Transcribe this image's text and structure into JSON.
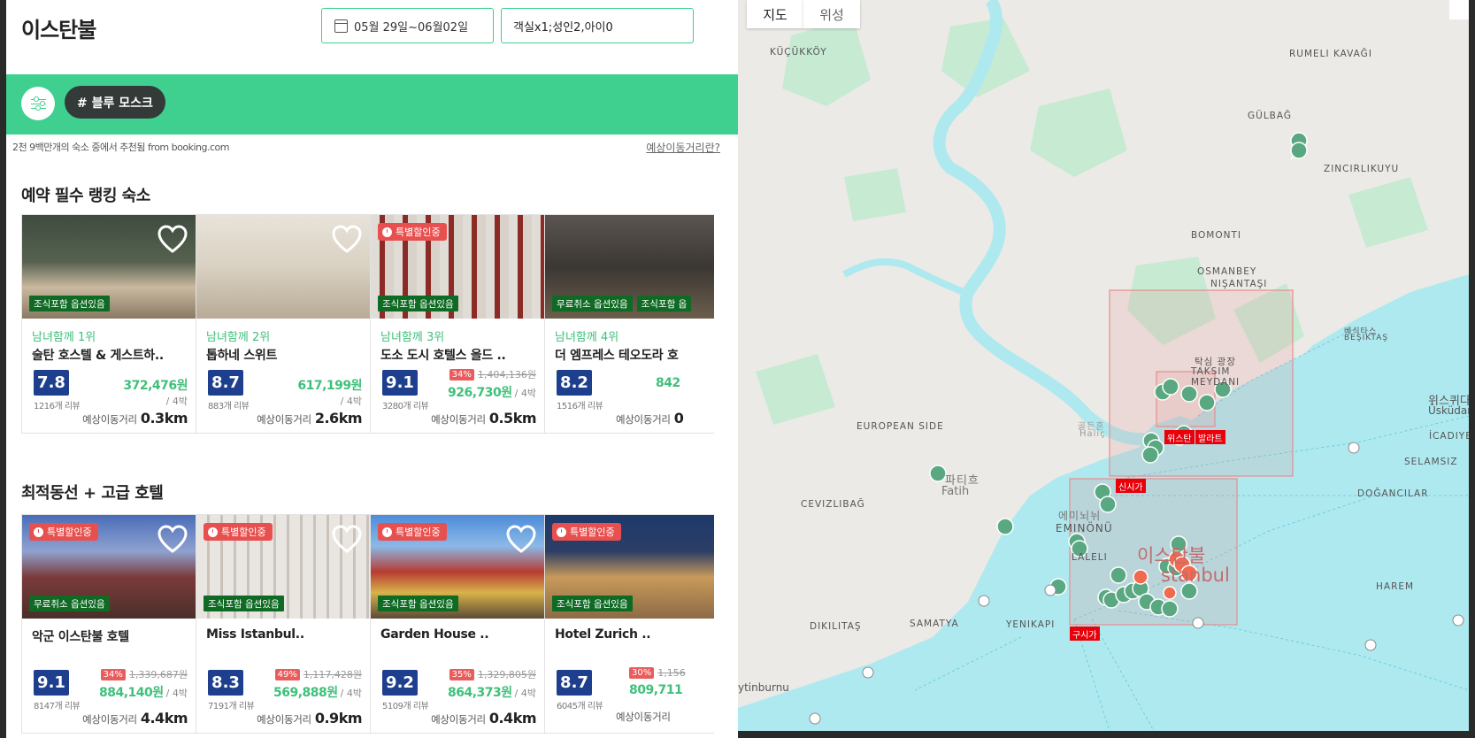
{
  "header": {
    "city": "이스탄불",
    "date_range": "05월 29일~06월02일",
    "rooms": "객실x1;성인2,아이0"
  },
  "filter_bar": {
    "tag": "# 블루 모스크"
  },
  "info": {
    "recommend_text": "2천 9백만개의 숙소 중에서 추천됨 from booking.com",
    "distance_link": "예상이동거리란?"
  },
  "sections": [
    {
      "title": "예약 필수 랭킹 숙소",
      "cards": [
        {
          "rank": "남녀함께 1위",
          "name": "술탄 호스텔 & 게스트하..",
          "score": "7.8",
          "reviews": "1216개 리뷰",
          "price": "372,476원",
          "per": "/ 4박",
          "dist_label": "예상이동거리",
          "dist": "0.3km",
          "badges": [
            "조식포함 옵션있음"
          ],
          "special": ""
        },
        {
          "rank": "남녀함께 2위",
          "name": "톱하네 스위트",
          "score": "8.7",
          "reviews": "883개 리뷰",
          "price": "617,199원",
          "per": "/ 4박",
          "dist_label": "예상이동거리",
          "dist": "2.6km",
          "badges": [],
          "special": ""
        },
        {
          "rank": "남녀함께 3위",
          "name": "도소 도시 호텔스 올드 ..",
          "score": "9.1",
          "reviews": "3280개 리뷰",
          "discount": "34%",
          "original": "1,404,136원",
          "price": "926,730원",
          "per": "/ 4박",
          "dist_label": "예상이동거리",
          "dist": "0.5km",
          "badges": [
            "조식포함 옵션있음"
          ],
          "special": "특별할인중"
        },
        {
          "rank": "남녀함께 4위",
          "name": "더 엠프레스 테오도라 호",
          "score": "8.2",
          "reviews": "1516개 리뷰",
          "price": "842",
          "per": "",
          "dist_label": "예상이동거리",
          "dist": "0",
          "badges": [
            "무료취소 옵션있음",
            "조식포함 옵"
          ],
          "special": ""
        }
      ]
    },
    {
      "title": "최적동선 + 고급 호텔",
      "cards": [
        {
          "rank": "",
          "name": "악군 이스탄불 호텔",
          "score": "9.1",
          "reviews": "8147개 리뷰",
          "discount": "34%",
          "original": "1,339,687원",
          "price": "884,140원",
          "per": "/ 4박",
          "dist_label": "예상이동거리",
          "dist": "4.4km",
          "badges": [
            "무료취소 옵션있음"
          ],
          "special": "특별할인중"
        },
        {
          "rank": "",
          "name": "Miss Istanbul..",
          "score": "8.3",
          "reviews": "7191개 리뷰",
          "discount": "49%",
          "original": "1,117,428원",
          "price": "569,888원",
          "per": "/ 4박",
          "dist_label": "예상이동거리",
          "dist": "0.9km",
          "badges": [
            "조식포함 옵션있음"
          ],
          "special": "특별할인중"
        },
        {
          "rank": "",
          "name": "Garden House ..",
          "score": "9.2",
          "reviews": "5109개 리뷰",
          "discount": "35%",
          "original": "1,329,805원",
          "price": "864,373원",
          "per": "/ 4박",
          "dist_label": "예상이동거리",
          "dist": "0.4km",
          "badges": [
            "조식포함 옵션있음"
          ],
          "special": "특별할인중"
        },
        {
          "rank": "",
          "name": "Hotel Zurich ..",
          "score": "8.7",
          "reviews": "6045개 리뷰",
          "discount": "30%",
          "original": "1,156",
          "price": "809,711",
          "per": "",
          "dist_label": "예상이동거리",
          "dist": "",
          "badges": [
            "조식포함 옵션있음"
          ],
          "special": "특별할인중"
        }
      ]
    }
  ],
  "map": {
    "tab_map": "지도",
    "tab_satellite": "위성",
    "labels": [
      "KÜÇÜKKÖY",
      "RUMELI KAVAĞI",
      "GÜLBAĞ",
      "ZINCIRLIKUYU",
      "BOMONTI",
      "OSMANBEY",
      "NIŞANTAŞI",
      "EUROPEAN SIDE",
      "CEVIZLIBAĞ",
      "DIKILITAŞ",
      "SAMATYA",
      "YENIKAPI",
      "DOĞANCILAR",
      "SELAMSIZ",
      "HAREM",
      "İCADIYE",
      "ytinburnu",
      "EMINÖNÜ",
      "LALELI",
      "탁심 광장",
      "TAKSIM",
      "MEYDANI",
      "베식타스",
      "BEŞIKTAŞ",
      "위스퀴다르",
      "Üsküdar",
      "골든혼",
      "Haliç",
      "파티흐",
      "Fatih",
      "에미뇌뉘",
      "이스탄불",
      "stanbul"
    ],
    "red_tags": [
      "신시가",
      "구시가",
      "위스탄",
      "발라트"
    ],
    "colors": {
      "water": "#aee9f0",
      "land": "#eceae6",
      "park": "#c7ead3",
      "pin": "#5aa882",
      "hot_pin": "#ef6a4f",
      "zone": "#e68e8e"
    }
  },
  "colors": {
    "accent": "#3fd08f",
    "score_bg": "#1e3f8e",
    "price": "#3fc07a",
    "discount": "#ea5b5b",
    "badge_green": "#0f6a24"
  }
}
